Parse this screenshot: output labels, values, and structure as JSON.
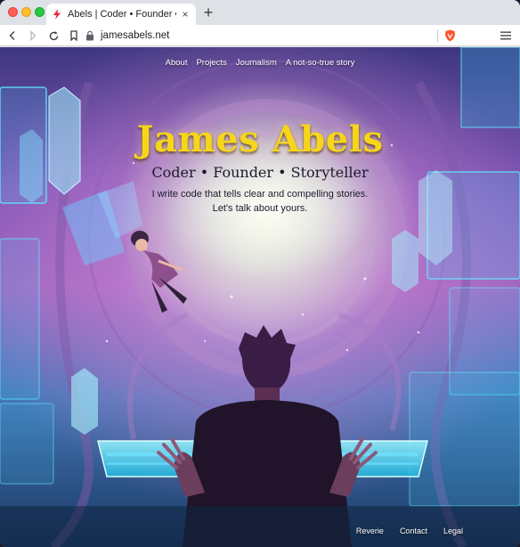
{
  "browser": {
    "tab_title": "Abels | Coder • Founder • Storyteller",
    "tab_close": "×",
    "new_tab": "+",
    "address": "jamesabels.net"
  },
  "nav": {
    "items": [
      "About",
      "Projects",
      "Journalism",
      "A not-so-true story"
    ]
  },
  "hero": {
    "title": "James Abels",
    "subtitle": "Coder • Founder • Storyteller",
    "description": "I write code that tells clear and compelling stories. Let's talk about yours."
  },
  "footer": {
    "links": [
      "Reverie",
      "Contact",
      "Legal"
    ]
  },
  "colors": {
    "title_gold": "#f6d51c",
    "neon_cyan": "#38e8ff",
    "favicon_red": "#e8243c",
    "brave_orange": "#fb542b"
  },
  "icons": {
    "back": "back-arrow-icon",
    "forward": "forward-arrow-icon",
    "reload": "reload-icon",
    "bookmark": "bookmark-icon",
    "lock": "lock-icon",
    "brave": "brave-shield-icon",
    "menu": "hamburger-menu-icon"
  }
}
